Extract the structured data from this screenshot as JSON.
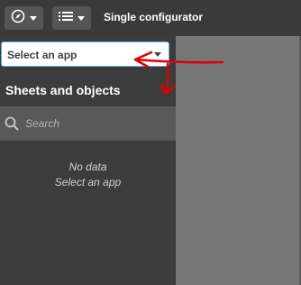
{
  "toolbar": {
    "title": "Single configurator",
    "buttons": [
      {
        "icon": "compass-icon"
      },
      {
        "icon": "list-icon"
      }
    ]
  },
  "sidebar": {
    "app_select_label": "Select an app",
    "section_title": "Sheets and objects",
    "search_placeholder": "Search",
    "empty_title": "No data",
    "empty_subtitle": "Select an app"
  },
  "colors": {
    "toolbar_bg": "#3a3a3a",
    "sidebar_bg": "#3c3c3c",
    "search_bg": "#595959",
    "right_area_bg": "#777777",
    "select_border": "#6aa9d8",
    "annotation": "#e00000"
  }
}
